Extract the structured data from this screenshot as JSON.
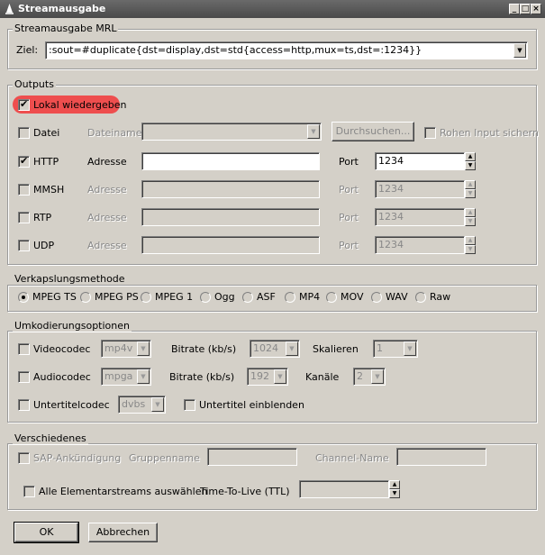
{
  "window": {
    "title": "Streamausgabe"
  },
  "mrl": {
    "group_title": "Streamausgabe MRL",
    "label": "Ziel:",
    "value": ":sout=#duplicate{dst=display,dst=std{access=http,mux=ts,dst=:1234}}"
  },
  "outputs": {
    "group_title": "Outputs",
    "local_play": {
      "label": "Lokal wiedergeben",
      "checked": true
    },
    "file": {
      "label": "Datei",
      "field_label": "Dateiname",
      "browse_label": "Durchsuchen...",
      "raw_input_label": "Rohen Input sichern"
    },
    "http": {
      "label": "HTTP",
      "checked": true,
      "address_label": "Adresse",
      "address_value": "",
      "port_label": "Port",
      "port_value": "1234"
    },
    "mmsh": {
      "label": "MMSH",
      "address_label": "Adresse",
      "port_label": "Port",
      "port_value": "1234"
    },
    "rtp": {
      "label": "RTP",
      "address_label": "Adresse",
      "port_label": "Port",
      "port_value": "1234"
    },
    "udp": {
      "label": "UDP",
      "address_label": "Adresse",
      "port_label": "Port",
      "port_value": "1234"
    }
  },
  "encap": {
    "group_title": "Verkapslungsmethode",
    "options": [
      "MPEG TS",
      "MPEG PS",
      "MPEG 1",
      "Ogg",
      "ASF",
      "MP4",
      "MOV",
      "WAV",
      "Raw"
    ],
    "selected": "MPEG TS"
  },
  "transcode": {
    "group_title": "Umkodierungsoptionen",
    "video": {
      "label": "Videocodec",
      "codec": "mp4v",
      "bitrate_label": "Bitrate (kb/s)",
      "bitrate": "1024",
      "scale_label": "Skalieren",
      "scale": "1"
    },
    "audio": {
      "label": "Audiocodec",
      "codec": "mpga",
      "bitrate_label": "Bitrate (kb/s)",
      "bitrate": "192",
      "channels_label": "Kanäle",
      "channels": "2"
    },
    "subtitle": {
      "label": "Untertitelcodec",
      "codec": "dvbs",
      "overlay_label": "Untertitel einblenden"
    }
  },
  "misc": {
    "group_title": "Verschiedenes",
    "sap_label": "SAP-Ankündigung",
    "group_name_label": "Gruppenname",
    "channel_name_label": "Channel-Name",
    "all_es_label": "Alle Elementarstreams auswählen",
    "ttl_label": "Time-To-Live (TTL)",
    "ttl_value": ""
  },
  "buttons": {
    "ok": "OK",
    "cancel": "Abbrechen"
  },
  "colors": {
    "titlebar": "#555555",
    "window_bg": "#d4d0c8",
    "highlight": "#ee4e4e"
  }
}
